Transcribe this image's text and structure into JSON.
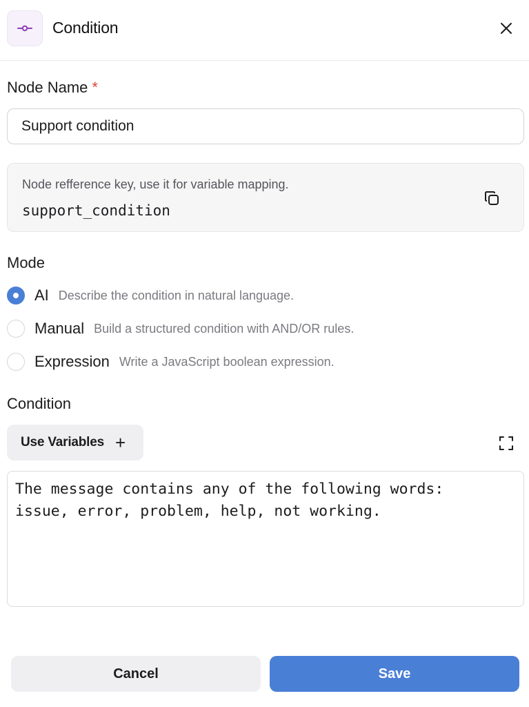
{
  "header": {
    "title": "Condition",
    "icon": "condition-node-icon",
    "icon_color": "#8e3fb8"
  },
  "node_name": {
    "label": "Node Name",
    "required_marker": "*",
    "value": "Support condition"
  },
  "reference": {
    "hint": "Node refference key, use it for variable mapping.",
    "key": "support_condition"
  },
  "mode": {
    "label": "Mode",
    "selected": "AI",
    "options": [
      {
        "label": "AI",
        "description": "Describe the condition in natural language."
      },
      {
        "label": "Manual",
        "description": "Build a structured condition with AND/OR rules."
      },
      {
        "label": "Expression",
        "description": "Write a JavaScript boolean expression."
      }
    ]
  },
  "condition": {
    "label": "Condition",
    "use_variables_label": "Use Variables",
    "text": "The message contains any of the following words:\nissue, error, problem, help, not working."
  },
  "footer": {
    "cancel_label": "Cancel",
    "save_label": "Save"
  },
  "colors": {
    "accent": "#4a7fd6",
    "required": "#d9473f"
  }
}
